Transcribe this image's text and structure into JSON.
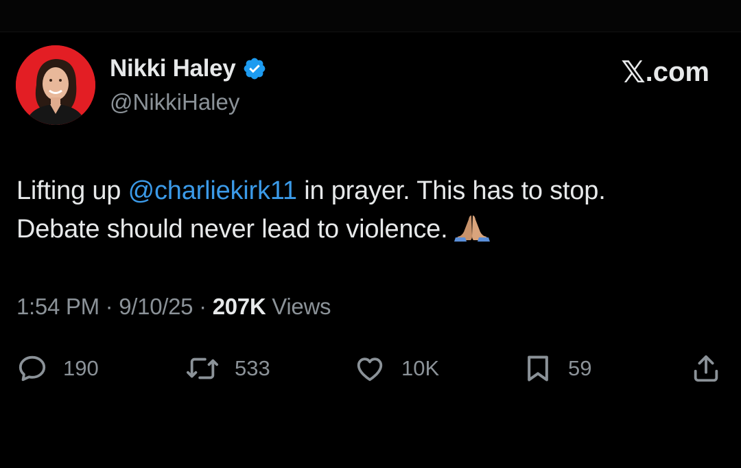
{
  "author": {
    "display_name": "Nikki Haley",
    "handle": "@NikkiHaley",
    "verified": true,
    "avatar_bg": "#e31e24"
  },
  "brand": {
    "x_glyph": "𝕏",
    "domain": ".com"
  },
  "tweet": {
    "text_before": "Lifting up ",
    "mention": "@charliekirk11",
    "text_after_line1": " in prayer. This has to stop.",
    "line2": "Debate should never lead to violence.",
    "emoji": "folded-hands"
  },
  "meta": {
    "time": "1:54 PM",
    "sep1": " · ",
    "date": "9/10/25",
    "sep2": " · ",
    "views_count": "207K",
    "views_label": " Views"
  },
  "actions": {
    "replies": "190",
    "reposts": "533",
    "likes": "10K",
    "bookmarks": "59"
  },
  "colors": {
    "background": "#000000",
    "text": "#e7e9ea",
    "muted": "#8b9298",
    "link": "#3b9ae8",
    "verified": "#1d9bf0"
  }
}
